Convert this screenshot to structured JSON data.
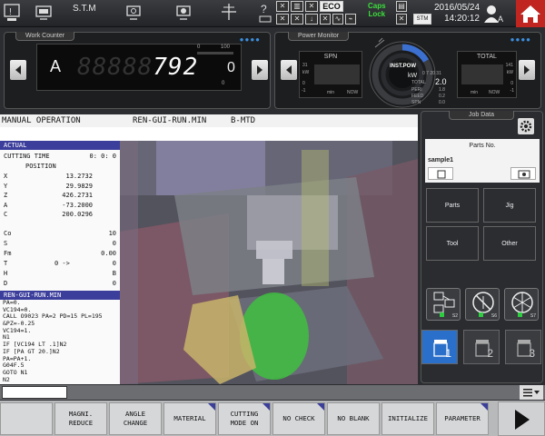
{
  "topbar": {
    "stm_label": "S.T.M",
    "eco_label": "ECO",
    "caps_lock": "Caps\nLock",
    "date": "2016/05/24",
    "time": "14:20:12",
    "stm_badge": "STM"
  },
  "work_counter": {
    "title": "Work Counter",
    "letter": "A",
    "ghost_digits": "88888",
    "digits": "792",
    "right_value": "0",
    "bar_min": "0",
    "bar_max": "100",
    "bar_bottom": "0"
  },
  "power_monitor": {
    "title": "Power Monitor",
    "spn_label": "SPN",
    "total_label": "TOTAL",
    "kw_label": "kW",
    "min_label": "min",
    "now_label": "NOW",
    "inst_pow": "INST.POW",
    "gauge_value": "2.0",
    "gauge_unit": "kW",
    "total_text": "TOTAL",
    "peri_label": "PERI",
    "peri_value": "1.8",
    "feed_label": "FEED",
    "feed_value": "0.2",
    "spn_small_label": "SPN",
    "spn_small_value": "0.0",
    "left_31": "31",
    "left_0": "0",
    "left_m1": "-1",
    "right_141": "141",
    "right_0": "0",
    "right_m1": "-1",
    "ticks": "0 7 20 31"
  },
  "title_row": {
    "mode": "MANUAL OPERATION",
    "program": "REN-GUI-RUN.MIN",
    "sub": "B-MTD"
  },
  "actual": {
    "header": "ACTUAL",
    "cutting_time_label": "CUTTING TIME",
    "cutting_time_value": "0: 0: 0",
    "position_label": "POSITION",
    "axes": [
      {
        "axis": "X",
        "value": "13.2732"
      },
      {
        "axis": "Y",
        "value": "29.9829"
      },
      {
        "axis": "Z",
        "value": "426.2731"
      },
      {
        "axis": "A",
        "value": "-73.2000"
      },
      {
        "axis": "C",
        "value": "200.0296"
      }
    ],
    "params": [
      {
        "label": "Co",
        "mid": "",
        "value": "10"
      },
      {
        "label": "S",
        "mid": "",
        "value": "0"
      },
      {
        "label": "Fm",
        "mid": "",
        "value": "0.00"
      },
      {
        "label": "T",
        "mid": "0 ->",
        "value": "0"
      },
      {
        "label": "H",
        "mid": "",
        "value": "B"
      },
      {
        "label": "D",
        "mid": "",
        "value": "0"
      }
    ]
  },
  "program": {
    "header": "REN-GUI-RUN.MIN",
    "lines": [
      "PA=0.",
      "VC194=0.",
      "CALL O9023 PA=2 PD=15 PL=195",
      "&PZ=-0.25",
      "VC194=1.",
      "N1",
      "IF [VC194 LT .1]N2",
      "IF [PA GT 20.]N2",
      "PA=PA+1.",
      "G04F.5",
      "GOTO N1",
      "N2"
    ]
  },
  "job_data": {
    "title": "Job Data",
    "parts_no": "Parts No.",
    "sample": "sample1",
    "buttons": [
      "Parts",
      "Jig",
      "Tool",
      "Other"
    ],
    "icon_labels": [
      "S2",
      "S6",
      "S7"
    ],
    "pages": [
      "1",
      "2",
      "3"
    ]
  },
  "softkeys": [
    {
      "line1": "",
      "line2": ""
    },
    {
      "line1": "MAGNI.",
      "line2": "REDUCE"
    },
    {
      "line1": "ANGLE",
      "line2": "CHANGE"
    },
    {
      "line1": "MATERIAL",
      "line2": ""
    },
    {
      "line1": "CUTTING",
      "line2": "MODE ON"
    },
    {
      "line1": "NO CHECK",
      "line2": ""
    },
    {
      "line1": "NO BLANK",
      "line2": ""
    },
    {
      "line1": "INITIALIZE",
      "line2": ""
    },
    {
      "line1": "PARAMETER",
      "line2": ""
    }
  ],
  "colors": {
    "accent_blue": "#3c3e9c",
    "home_red": "#c0261f",
    "active_page": "#2a6fc9",
    "caps_green": "#3be03b"
  }
}
